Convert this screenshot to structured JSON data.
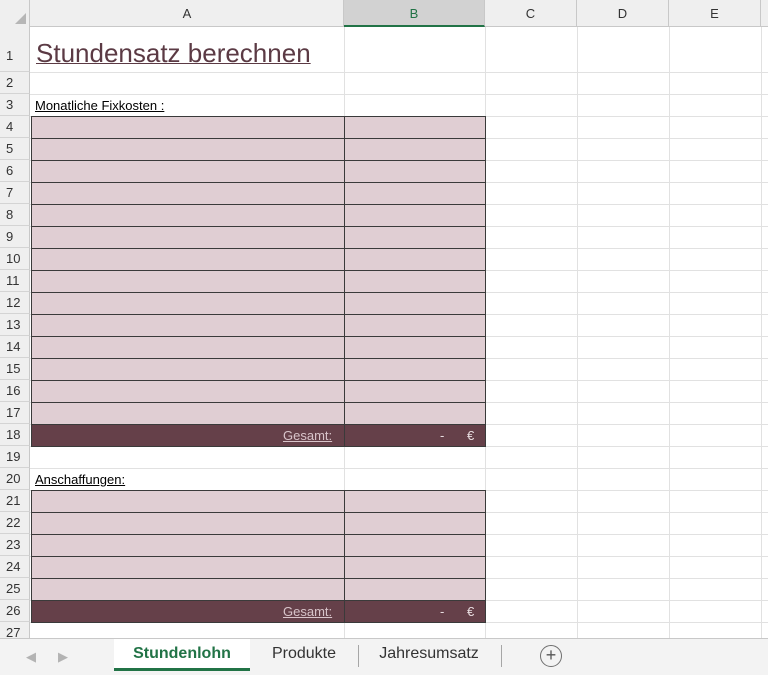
{
  "columns": [
    "A",
    "B",
    "C",
    "D",
    "E"
  ],
  "rows": [
    "1",
    "2",
    "3",
    "4",
    "5",
    "6",
    "7",
    "8",
    "9",
    "10",
    "11",
    "12",
    "13",
    "14",
    "15",
    "16",
    "17",
    "18",
    "19",
    "20",
    "21",
    "22",
    "23",
    "24",
    "25",
    "26",
    "27"
  ],
  "cells": {
    "title": "Stundensatz berechnen",
    "fixkosten_label": "Monatliche Fixkosten :",
    "fixkosten_total_label": "Gesamt:",
    "fixkosten_total_dash": "-",
    "fixkosten_total_currency": "€",
    "anschaffungen_label": "Anschaffungen:",
    "anschaffungen_total_label": "Gesamt:",
    "anschaffungen_total_dash": "-",
    "anschaffungen_total_currency": "€"
  },
  "tabs": {
    "items": [
      {
        "label": "Stundenlohn",
        "active": true
      },
      {
        "label": "Produkte",
        "active": false
      },
      {
        "label": "Jahresumsatz",
        "active": false
      }
    ],
    "add_symbol": "+",
    "prev_symbol": "◀",
    "next_symbol": "▶"
  },
  "colors": {
    "fill_light": "#e0ced3",
    "fill_dark": "#654049",
    "title": "#5b3a44",
    "accent": "#217346"
  }
}
